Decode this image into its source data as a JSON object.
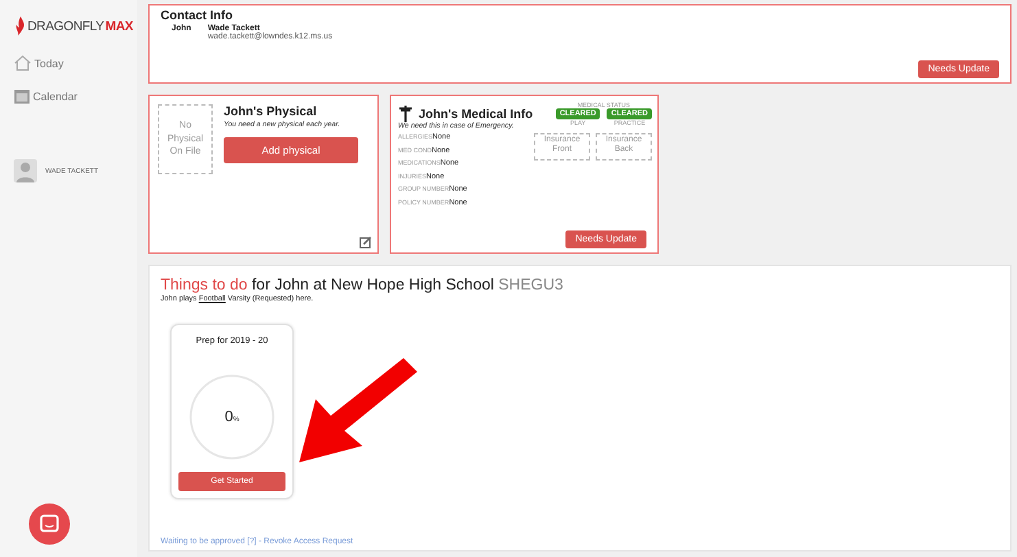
{
  "sidebar": {
    "logo": {
      "brand": "DRAGONFLY",
      "accent": "MAX"
    },
    "items": [
      {
        "label": "Today",
        "kind": "home"
      },
      {
        "label": "Calendar",
        "kind": "calendar"
      }
    ],
    "user": "WADE TACKETT"
  },
  "contact": {
    "title": "Contact Info",
    "relation": "John",
    "name": "Wade Tackett",
    "email": "wade.tackett@lowndes.k12.ms.us",
    "button": "Needs Update"
  },
  "physical": {
    "placeholder": "No Physical On File",
    "title": "John's Physical",
    "note": "You need a new physical each year.",
    "button": "Add physical"
  },
  "medical": {
    "title": "John's Medical Info",
    "note": "We need this in case of Emergency.",
    "status_label": "MEDICAL STATUS",
    "statuses": [
      {
        "badge": "CLEARED",
        "label": "PLAY"
      },
      {
        "badge": "CLEARED",
        "label": "PRACTICE"
      }
    ],
    "fields": [
      {
        "label": "ALLERGIES",
        "value": "None"
      },
      {
        "label": "MED COND",
        "value": "None"
      },
      {
        "label": "MEDICATIONS",
        "value": "None"
      },
      {
        "label": "INJURIES",
        "value": "None"
      },
      {
        "label": "GROUP NUMBER",
        "value": "None"
      },
      {
        "label": "POLICY NUMBER",
        "value": "None"
      }
    ],
    "insurance": [
      "Insurance Front",
      "Insurance Back"
    ],
    "button": "Needs Update"
  },
  "todo": {
    "title_accent": "Things to do",
    "title_rest": "for John at New Hope High School",
    "code": "SHEGU3",
    "sub_before": "John plays",
    "sport": "Football",
    "sub_after": "Varsity (Requested) here.",
    "prep": {
      "title": "Prep for 2019 - 20",
      "percent": "0",
      "unit": "%",
      "level": 0,
      "button": "Get Started"
    },
    "footer": "Waiting to be approved [?] - Revoke Access Request"
  }
}
